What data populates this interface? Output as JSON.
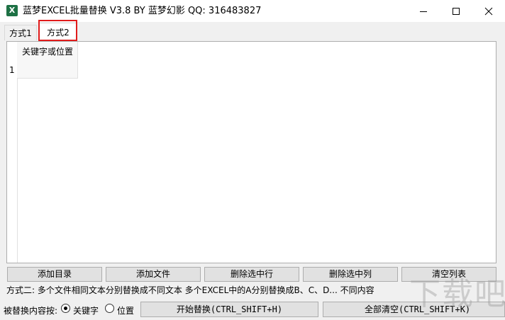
{
  "window": {
    "icon_letter": "X",
    "title": "蓝梦EXCEL批量替换 V3.8 BY 蓝梦幻影 QQ: 316483827"
  },
  "tabs": [
    {
      "label": "方式1",
      "active": false
    },
    {
      "label": "方式2",
      "active": true
    }
  ],
  "grid": {
    "column_header": "关键字或位置",
    "row_number": "1"
  },
  "buttons": {
    "add_dir": "添加目录",
    "add_file": "添加文件",
    "delete_row": "删除选中行",
    "delete_col": "删除选中列",
    "clear_list": "清空列表"
  },
  "description": "方式二: 多个文件相同文本分别替换成不同文本  多个EXCEL中的A分别替换成B、C、D...  不同内容",
  "bottom": {
    "label": "被替换内容按:",
    "radio_keyword": "关键字",
    "radio_position": "位置",
    "start_replace": "开始替换(CTRL_SHIFT+H)",
    "clear_all": "全部清空(CTRL_SHIFT+K)"
  },
  "watermark": "下载吧",
  "colors": {
    "highlight": "#e01b1b",
    "excel_icon": "#1e7145"
  }
}
